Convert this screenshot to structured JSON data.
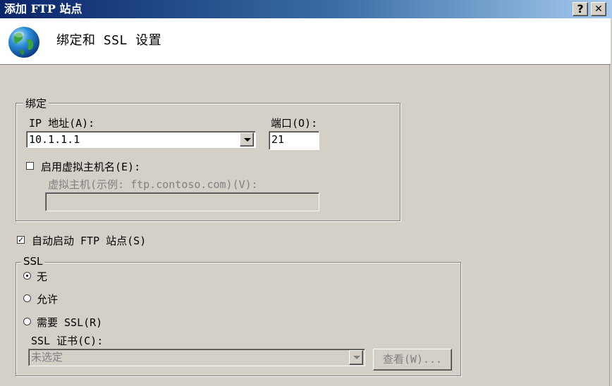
{
  "window": {
    "title": "添加 FTP 站点",
    "help_label": "?",
    "close_label": "✕"
  },
  "header": {
    "title": "绑定和 SSL 设置",
    "icon": "globe-icon"
  },
  "binding": {
    "group_label": "绑定",
    "ip_label": "IP 地址(A):",
    "ip_value": "10.1.1.1",
    "port_label": "端口(O):",
    "port_value": "21",
    "virtual_host_checkbox_label": "启用虚拟主机名(E):",
    "virtual_host_checked": false,
    "virtual_host_label": "虚拟主机(示例: ftp.contoso.com)(V):",
    "virtual_host_value": ""
  },
  "auto_start": {
    "label": "自动启动 FTP 站点(S)",
    "checked": true
  },
  "ssl": {
    "group_label": "SSL",
    "options": [
      {
        "label": "无",
        "selected": true
      },
      {
        "label": "允许",
        "selected": false
      },
      {
        "label": "需要 SSL(R)",
        "selected": false
      }
    ],
    "cert_label": "SSL 证书(C):",
    "cert_value": "未选定",
    "view_button_label": "查看(W)..."
  }
}
